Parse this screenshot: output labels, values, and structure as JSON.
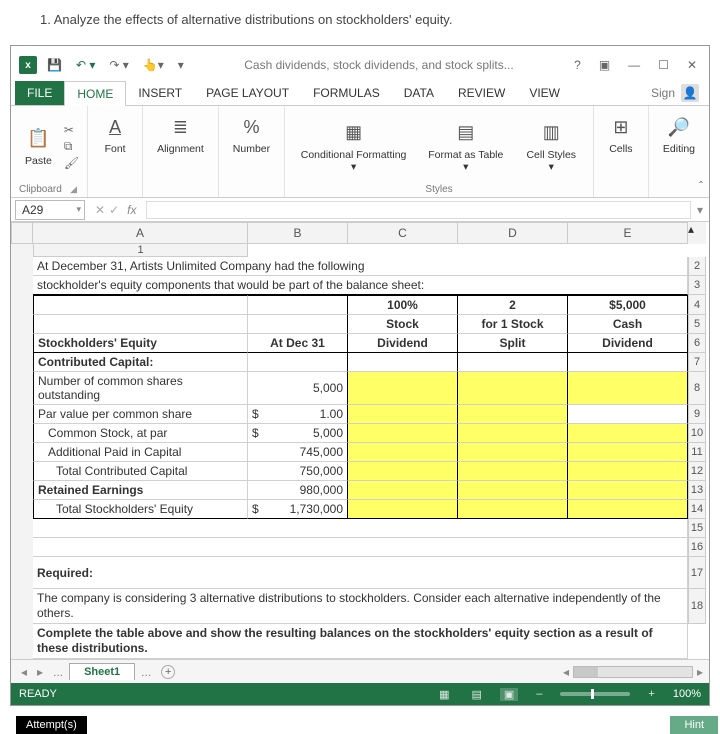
{
  "question": "1. Analyze the effects of alternative distributions on stockholders' equity.",
  "titlebar": {
    "app_initials": "x",
    "doc_title": "Cash dividends, stock dividends, and stock splits...",
    "help": "?"
  },
  "ribbon_tabs": {
    "file": "FILE",
    "home": "HOME",
    "insert": "INSERT",
    "page_layout": "PAGE LAYOUT",
    "formulas": "FORMULAS",
    "data": "DATA",
    "review": "REVIEW",
    "view": "VIEW",
    "sign_in": "Sign"
  },
  "ribbon": {
    "clipboard": {
      "paste": "Paste",
      "label": "Clipboard"
    },
    "font": {
      "btn": "Font"
    },
    "alignment": {
      "btn": "Alignment"
    },
    "number": {
      "btn": "Number",
      "glyph": "%"
    },
    "styles": {
      "cond": "Conditional Formatting ▾",
      "fmt_table": "Format as Table ▾",
      "cell_styles": "Cell Styles ▾",
      "label": "Styles"
    },
    "cells": {
      "btn": "Cells"
    },
    "editing": {
      "btn": "Editing"
    }
  },
  "namebox": "A29",
  "fx": "fx",
  "columns": [
    "",
    "A",
    "B",
    "C",
    "D",
    "E"
  ],
  "rows": {
    "r1": "At December 31,  Artists Unlimited Company had the following",
    "r2": "stockholder's equity components that would be part of the balance sheet:",
    "r3": {
      "c": "100%",
      "d": "2",
      "e": "$5,000"
    },
    "r4": {
      "c": "Stock",
      "d": "for 1 Stock",
      "e": "Cash"
    },
    "r5": {
      "a": "Stockholders' Equity",
      "b": "At Dec 31",
      "c": "Dividend",
      "d": "Split",
      "e": "Dividend"
    },
    "r6": "Contributed Capital:",
    "r7": {
      "a": "Number of common shares outstanding",
      "b": "5,000"
    },
    "r8": {
      "a": "Par value per common share",
      "b_pfx": "$",
      "b": "1.00"
    },
    "r9": {
      "a": "   Common Stock, at par",
      "b_pfx": "$",
      "b": "5,000"
    },
    "r10": {
      "a": "   Additional Paid in Capital",
      "b": "745,000"
    },
    "r11": {
      "a": "     Total Contributed Capital",
      "b": "750,000"
    },
    "r12": {
      "a": "Retained Earnings",
      "b": "980,000"
    },
    "r13": {
      "a": "     Total Stockholders' Equity",
      "b_pfx": "$",
      "b": "1,730,000"
    },
    "r16": "Required:",
    "r17": "The company is considering 3 alternative distributions to stockholders.  Consider each alternative independently of the others.",
    "r18": "Complete the table above and show the resulting balances on the stockholders' equity section as a result of these distributions."
  },
  "sheet_tabs": {
    "active": "Sheet1",
    "dots": "..."
  },
  "statusbar": {
    "ready": "READY",
    "zoom": "100%"
  },
  "below": {
    "attempts": "Attempt(s)",
    "hint": "Hint"
  }
}
